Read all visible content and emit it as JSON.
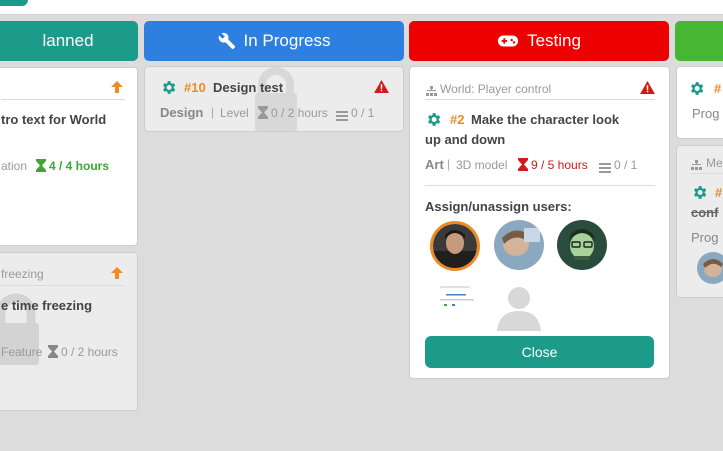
{
  "columns": [
    {
      "label": "lanned",
      "color": "#1d9b8a"
    },
    {
      "label": "In Progress",
      "color": "#2d7fe0"
    },
    {
      "label": "Testing",
      "color": "#ec0000"
    },
    {
      "label": "",
      "color": "#47b632"
    }
  ],
  "cards": {
    "planned_1": {
      "title": "tro text for World",
      "meta_cat": "ation",
      "hours": "4 / 4 hours"
    },
    "planned_2": {
      "header": "freezing",
      "title": "e time freezing",
      "meta_cat": "Feature",
      "hours": "0 / 2 hours"
    },
    "progress_1": {
      "number": "#10",
      "title": "Design test",
      "category": "Design",
      "subcategory": "Level",
      "hours": "0 / 2 hours",
      "tasks": "0 / 1"
    },
    "testing_1": {
      "header": "World: Player control",
      "number": "#2",
      "title_line1": "Make the character look",
      "title_line2": "up and down",
      "category": "Art",
      "subcategory": "3D model",
      "hours": "9 / 5 hours",
      "tasks": "0 / 1",
      "assign_label": "Assign/unassign users:",
      "close_label": "Close"
    },
    "right_1": {
      "number": "#",
      "category": "Prog"
    },
    "right_2": {
      "header": "Me",
      "number": "#",
      "title": "conf",
      "category": "Prog"
    }
  },
  "colors": {
    "teal": "#1d9b8a",
    "orange": "#f08a22",
    "red": "#d01a1a",
    "green": "#3fa535"
  }
}
